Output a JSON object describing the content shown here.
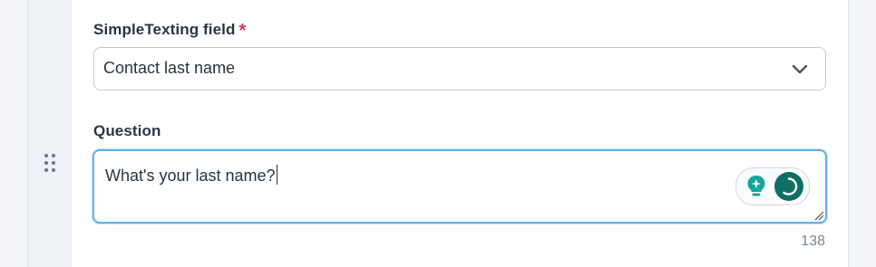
{
  "form": {
    "field_label": "SimpleTexting field",
    "required_marker": "*",
    "field_value": "Contact last name",
    "question_label": "Question",
    "question_value": "What's your last name?",
    "char_count": "138"
  },
  "icons": {
    "drag_handle": "drag-handle-icon",
    "select_chevron": "chevron-down-icon",
    "ai_suggest": "lightbulb-sparkle-icon",
    "ai_loading": "loading-spinner-icon",
    "resize": "resize-grip-icon"
  },
  "colors": {
    "required": "#d9345a",
    "focus_border": "#5eb5ec",
    "accent": "#0f6f66",
    "text": "#2b3646",
    "muted": "#7b8593"
  }
}
